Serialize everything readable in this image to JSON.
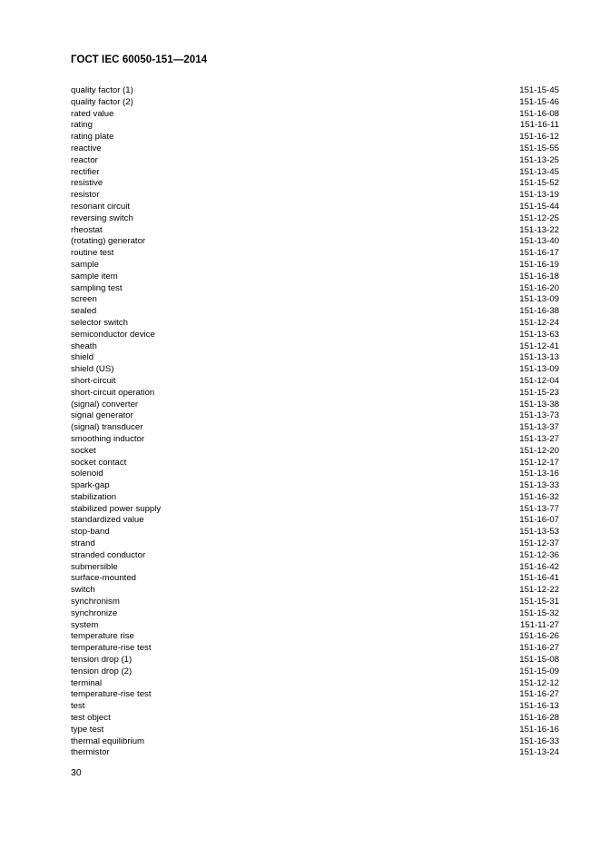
{
  "header": {
    "title": "ГОСТ IEC 60050-151—2014"
  },
  "entries": [
    {
      "term": "quality factor (1)",
      "ref": "151-15-45"
    },
    {
      "term": "quality factor (2)",
      "ref": "151-15-46"
    },
    {
      "term": "rated value",
      "ref": "151-16-08"
    },
    {
      "term": "rating",
      "ref": "151-16-11"
    },
    {
      "term": "rating plate",
      "ref": "151-16-12"
    },
    {
      "term": "reactive",
      "ref": "151-15-55"
    },
    {
      "term": "reactor",
      "ref": "151-13-25"
    },
    {
      "term": "rectifier",
      "ref": "151-13-45"
    },
    {
      "term": "resistive",
      "ref": "151-15-52"
    },
    {
      "term": "resistor",
      "ref": "151-13-19"
    },
    {
      "term": "resonant circuit",
      "ref": "151-15-44"
    },
    {
      "term": "reversing switch",
      "ref": "151-12-25"
    },
    {
      "term": "rheostat",
      "ref": "151-13-22"
    },
    {
      "term": "(rotating) generator",
      "ref": "151-13-40"
    },
    {
      "term": "routine test",
      "ref": "151-16-17"
    },
    {
      "term": "sample",
      "ref": "151-16-19"
    },
    {
      "term": "sample item",
      "ref": "151-16-18"
    },
    {
      "term": "sampling test",
      "ref": "151-16-20"
    },
    {
      "term": "screen",
      "ref": "151-13-09"
    },
    {
      "term": "sealed",
      "ref": "151-16-38"
    },
    {
      "term": "selector switch",
      "ref": "151-12-24"
    },
    {
      "term": "semiconductor device",
      "ref": "151-13-63"
    },
    {
      "term": "sheath",
      "ref": "151-12-41"
    },
    {
      "term": "shield",
      "ref": "151-13-13"
    },
    {
      "term": "shield (US)",
      "ref": "151-13-09"
    },
    {
      "term": "short-circuit",
      "ref": "151-12-04"
    },
    {
      "term": "short-circuit operation",
      "ref": "151-15-23"
    },
    {
      "term": "(signal) converter",
      "ref": "151-13-38"
    },
    {
      "term": "signal generator",
      "ref": "151-13-73"
    },
    {
      "term": "(signal) transducer",
      "ref": "151-13-37"
    },
    {
      "term": "smoothing inductor",
      "ref": "151-13-27"
    },
    {
      "term": "socket",
      "ref": "151-12-20"
    },
    {
      "term": "socket contact",
      "ref": "151-12-17"
    },
    {
      "term": "solenoid",
      "ref": "151-13-16"
    },
    {
      "term": "spark-gap",
      "ref": "151-13-33"
    },
    {
      "term": "stabilization",
      "ref": "151-16-32"
    },
    {
      "term": "stabilized power supply",
      "ref": "151-13-77"
    },
    {
      "term": "standardized value",
      "ref": "151-16-07"
    },
    {
      "term": "stop-band",
      "ref": "151-13-53"
    },
    {
      "term": "strand",
      "ref": "151-12-37"
    },
    {
      "term": "stranded conductor",
      "ref": "151-12-36"
    },
    {
      "term": "submersible",
      "ref": "151-16-42"
    },
    {
      "term": "surface-mounted",
      "ref": "151-16-41"
    },
    {
      "term": "switch",
      "ref": "151-12-22"
    },
    {
      "term": "synchronism",
      "ref": "151-15-31"
    },
    {
      "term": "synchronize",
      "ref": "151-15-32"
    },
    {
      "term": "system",
      "ref": "151-11-27"
    },
    {
      "term": "temperature rise",
      "ref": "151-16-26"
    },
    {
      "term": "temperature-rise test",
      "ref": "151-16-27"
    },
    {
      "term": "tension drop (1)",
      "ref": "151-15-08"
    },
    {
      "term": "tension drop (2)",
      "ref": "151-15-09"
    },
    {
      "term": "terminal",
      "ref": "151-12-12"
    },
    {
      "term": "temperature-rise test",
      "ref": "151-16-27"
    },
    {
      "term": "test",
      "ref": "151-16-13"
    },
    {
      "term": "test object",
      "ref": "151-16-28"
    },
    {
      "term": "type test",
      "ref": "151-16-16"
    },
    {
      "term": "thermal equilibrium",
      "ref": "151-16-33"
    },
    {
      "term": "thermistor",
      "ref": "151-13-24"
    }
  ],
  "footer": {
    "page_number": "30"
  }
}
